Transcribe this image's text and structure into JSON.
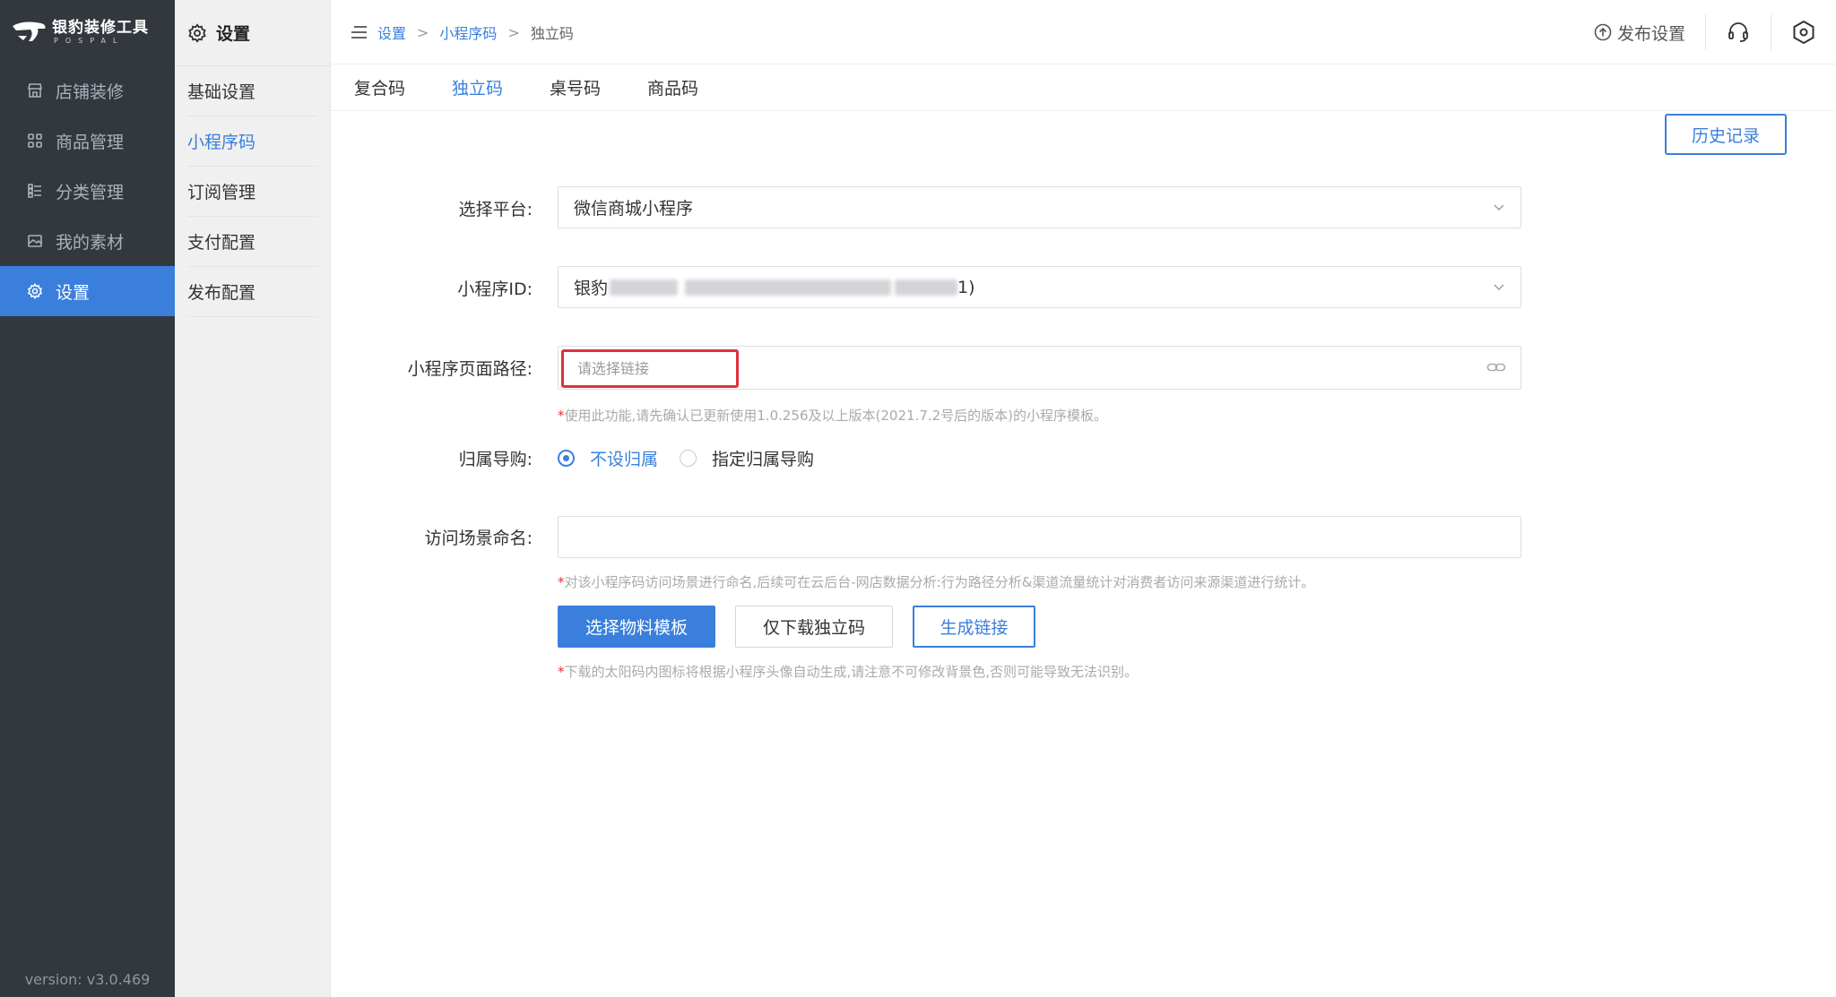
{
  "app": {
    "logo_text": "银豹装修工具",
    "logo_sub": "POSPAL",
    "version": "version: v3.0.469"
  },
  "sidebar": {
    "items": [
      {
        "label": "店铺装修",
        "icon": "store-icon"
      },
      {
        "label": "商品管理",
        "icon": "grid-icon"
      },
      {
        "label": "分类管理",
        "icon": "list-icon"
      },
      {
        "label": "我的素材",
        "icon": "image-icon"
      },
      {
        "label": "设置",
        "icon": "gear-icon",
        "active": true
      }
    ]
  },
  "subnav": {
    "title": "设置",
    "items": [
      {
        "label": "基础设置"
      },
      {
        "label": "小程序码",
        "active": true
      },
      {
        "label": "订阅管理"
      },
      {
        "label": "支付配置"
      },
      {
        "label": "发布配置"
      }
    ]
  },
  "topbar": {
    "breadcrumb": [
      "设置",
      "小程序码",
      "独立码"
    ],
    "separator": ">",
    "publish_label": "发布设置"
  },
  "tabs": [
    {
      "label": "复合码"
    },
    {
      "label": "独立码",
      "active": true
    },
    {
      "label": "桌号码"
    },
    {
      "label": "商品码"
    }
  ],
  "form": {
    "history_button": "历史记录",
    "platform_label": "选择平台:",
    "platform_value": "微信商城小程序",
    "appid_label": "小程序ID:",
    "appid_prefix": "银豹",
    "appid_suffix": "1)",
    "path_label": "小程序页面路径:",
    "path_placeholder": "请选择链接",
    "path_hint": "使用此功能,请先确认已更新使用1.0.256及以上版本(2021.7.2号后的版本)的小程序模板。",
    "guide_label": "归属导购:",
    "guide_options": [
      {
        "label": "不设归属",
        "checked": true
      },
      {
        "label": "指定归属导购",
        "checked": false
      }
    ],
    "scene_label": "访问场景命名:",
    "scene_value": "",
    "scene_hint": "对该小程序码访问场景进行命名,后续可在云后台-网店数据分析:行为路径分析&渠道流量统计对消费者访问来源渠道进行统计。",
    "btn_template": "选择物料模板",
    "btn_download": "仅下载独立码",
    "btn_link": "生成链接",
    "footer_hint": "下载的太阳码内图标将根据小程序头像自动生成,请注意不可修改背景色,否则可能导致无法识别。",
    "hint_star": "*"
  },
  "colors": {
    "accent": "#3a7fdb",
    "sidebar_bg": "#33383f",
    "highlight_border": "#e0303c"
  }
}
